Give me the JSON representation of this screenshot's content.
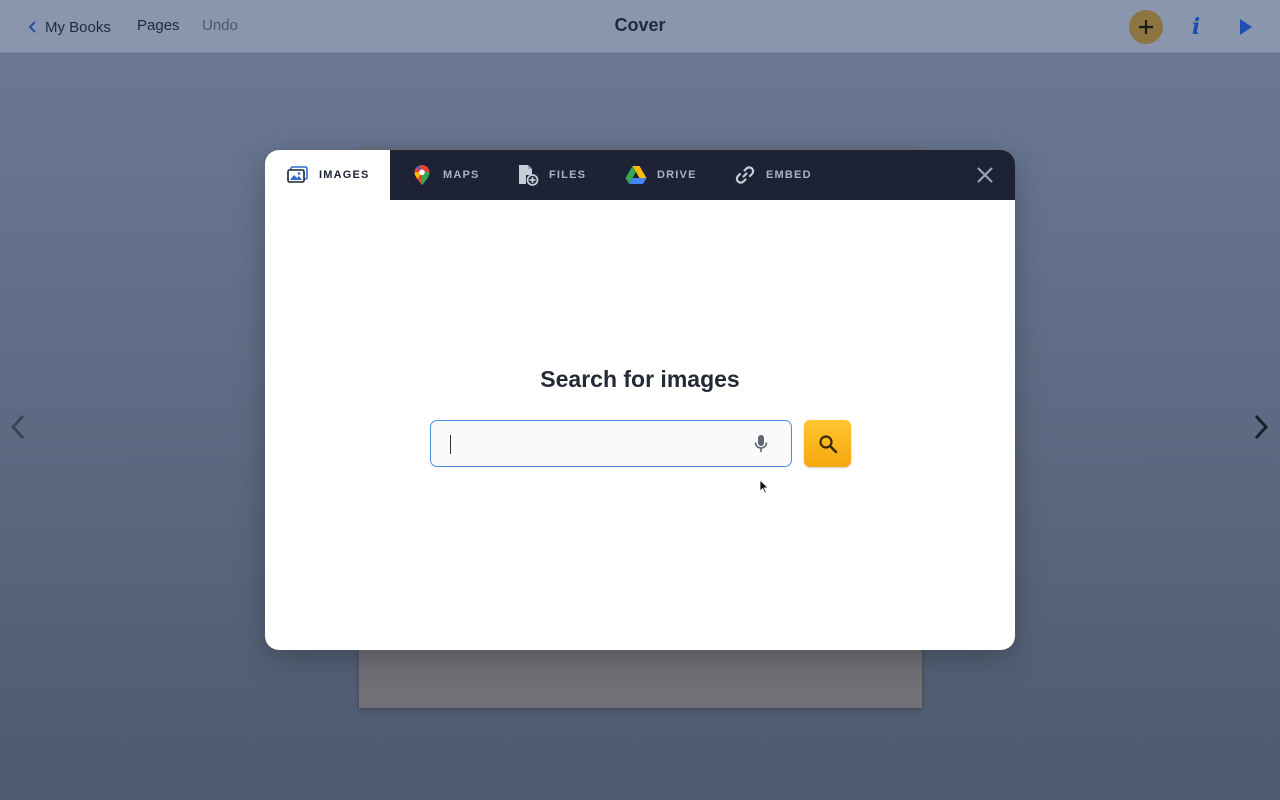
{
  "topbar": {
    "back_label": "My Books",
    "pages_label": "Pages",
    "undo_label": "Undo",
    "title": "Cover",
    "info_label": "i"
  },
  "modal": {
    "tabs": [
      {
        "label": "IMAGES",
        "icon": "image-icon",
        "active": true
      },
      {
        "label": "MAPS",
        "icon": "map-pin-icon",
        "active": false
      },
      {
        "label": "FILES",
        "icon": "file-add-icon",
        "active": false
      },
      {
        "label": "DRIVE",
        "icon": "google-drive-icon",
        "active": false
      },
      {
        "label": "EMBED",
        "icon": "link-icon",
        "active": false
      }
    ],
    "heading": "Search for images",
    "search": {
      "value": "",
      "placeholder": ""
    }
  },
  "colors": {
    "tab_bar": "#1d2334",
    "accent_blue": "#4a8fe3",
    "search_button": "#f5a80d",
    "add_button": "#8c7540"
  }
}
